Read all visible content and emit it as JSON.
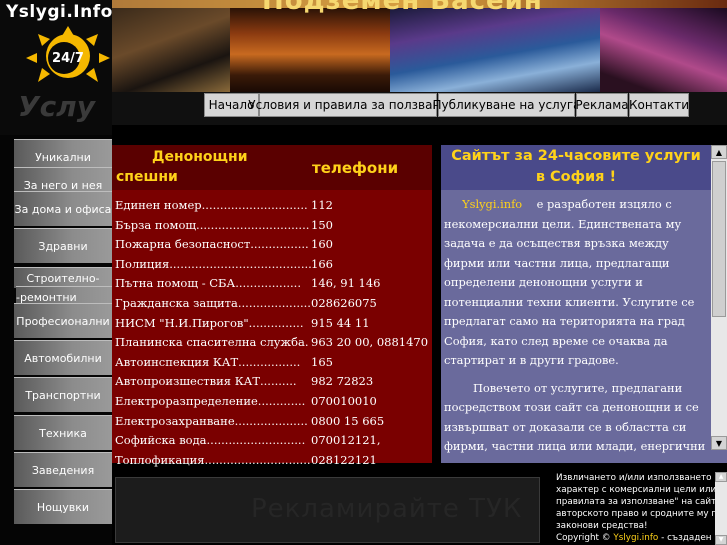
{
  "logo": {
    "site_name": "Yslygi.Info",
    "badge": "24/7",
    "ghost_text": "Услу"
  },
  "banner": {
    "headline": "Подземен Басейн"
  },
  "nav": {
    "items": [
      "Начало",
      "Условия и правила за ползване",
      "Публикуване на услуга",
      "Реклама",
      "Контакти"
    ]
  },
  "sidebar": {
    "items": [
      "Уникални",
      "За него и нея",
      "За дома и офиса",
      "Здравни",
      "Строително-",
      "-ремонтни",
      "Професионални",
      "Автомобилни",
      "Транспортни",
      "Техника",
      "Заведения",
      "Нощувки"
    ]
  },
  "emergency": {
    "title_line1": "Денонощни",
    "title_line2": "спешни",
    "title_phones": "телефони",
    "rows": [
      {
        "name": "Единен номер.............................",
        "phone": "112"
      },
      {
        "name": "Бърза помощ...............................",
        "phone": "150"
      },
      {
        "name": "Пожарна безопасност................",
        "phone": "160"
      },
      {
        "name": "Полиция.......................................",
        "phone": "166"
      },
      {
        "name": "Пътна помощ - СБА..................",
        "phone": "146, 91 146"
      },
      {
        "name": "Гражданска защита....................",
        "phone": "028626075"
      },
      {
        "name": "НИСМ \"Н.И.Пирогов\"...............",
        "phone": "915 44 11"
      },
      {
        "name": "Планинска спасителна служба.",
        "phone": "963 20 00, 0881470"
      },
      {
        "name": "Автоинспекция КАТ.................",
        "phone": "165"
      },
      {
        "name": "Автопроизшествия КАТ..........",
        "phone": "982 72823"
      },
      {
        "name": "Електроразпределение.............",
        "phone": "070010010"
      },
      {
        "name": "Електрозахранване....................",
        "phone": "0800 15 665"
      },
      {
        "name": "Софийска вода...........................",
        "phone": "070012121,"
      },
      {
        "name": "Топлофикация.............................",
        "phone": "028122121"
      }
    ]
  },
  "info": {
    "title_line1": "Сайтът за 24-часовите услуги",
    "title_line2": "в София !",
    "site_ref": "Yslygi.info",
    "para1": "е разработен изцяло с некомерсиални цели. Единствената му задача е да осъществя връзка между фирми или     частни лица, предлагащи определени денонощни услуги и потенциални техни клиенти. Услугите         се предлагат само на територията на град София, като след време се очаква да        стартират и в други градове.",
    "para2": "Повечето от услугите, предлагани посредством този сайт са денонощни и се извършват от доказали се в областта си фирми, частни лица или млади, енергични и отговорни хора  с нестихващ ентусиазъм и амбиции за развитие в избраната от тях сфера."
  },
  "ad": {
    "text": "Рекламирайте ТУК"
  },
  "footer": {
    "lines": [
      "Извличането и/или използването на инфо",
      "характер с комерсиални цели или цели, р",
      "правилата за използване\" на сайта,  е пре",
      "авторското право и сродните му права и д",
      "законови средства!"
    ],
    "copyright_prefix": "Copyright ©",
    "copyright_site": "Yslygi.info",
    "copyright_suffix": "- създаден през 20"
  }
}
